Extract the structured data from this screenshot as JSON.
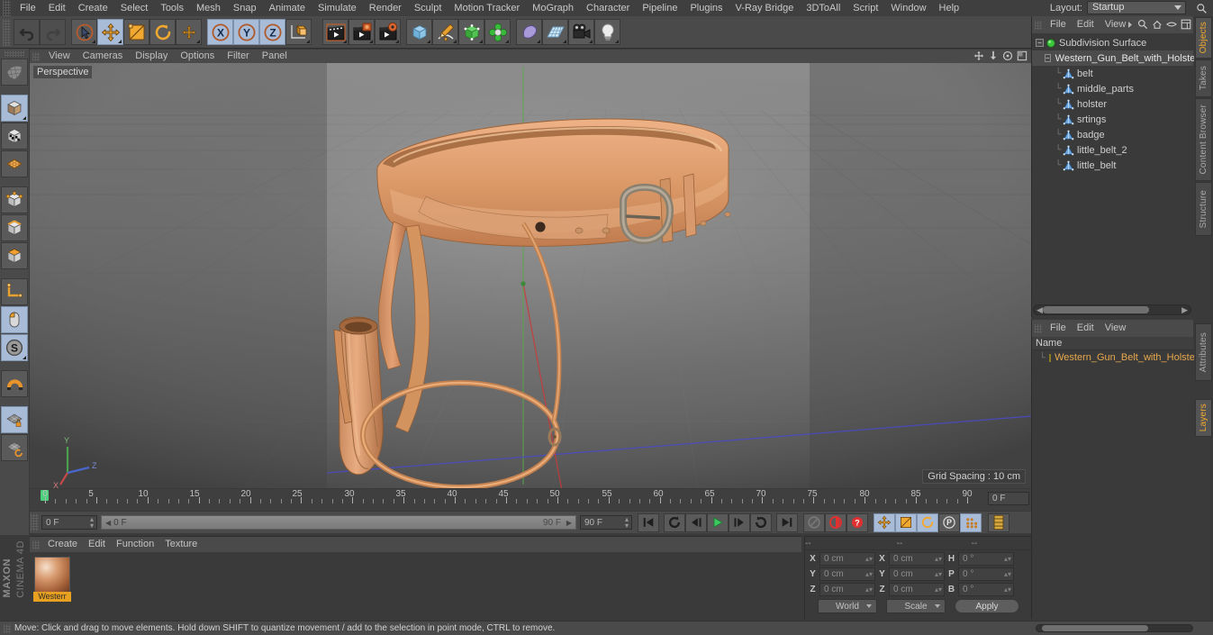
{
  "app": {
    "brand_line1": "MAXON",
    "brand_line2": "CINEMA 4D"
  },
  "menubar": {
    "items": [
      "File",
      "Edit",
      "Create",
      "Select",
      "Tools",
      "Mesh",
      "Snap",
      "Animate",
      "Simulate",
      "Render",
      "Sculpt",
      "Motion Tracker",
      "MoGraph",
      "Character",
      "Pipeline",
      "Plugins",
      "V-Ray Bridge",
      "3DToAll",
      "Script",
      "Window",
      "Help"
    ],
    "layout_label": "Layout:",
    "layout_value": "Startup",
    "search_icon": "magnifier-icon"
  },
  "toolbar": {
    "buttons": [
      {
        "name": "undo-button",
        "icon": "undo-arrow-icon",
        "selected": false
      },
      {
        "name": "redo-button",
        "icon": "redo-arrow-icon",
        "selected": false
      },
      {
        "name": "live-selection-tool",
        "icon": "cursor-circle-icon",
        "selected": false
      },
      {
        "name": "move-tool",
        "icon": "move-cross-icon",
        "selected": true
      },
      {
        "name": "scale-tool",
        "icon": "scale-square-icon",
        "selected": false
      },
      {
        "name": "rotate-tool",
        "icon": "rotate-circle-icon",
        "selected": false
      },
      {
        "name": "axis-move-tool",
        "icon": "small-cross-icon",
        "selected": false
      },
      {
        "name": "x-axis-lock",
        "icon": "x-axis-icon",
        "selected": true
      },
      {
        "name": "y-axis-lock",
        "icon": "y-axis-icon",
        "selected": true
      },
      {
        "name": "z-axis-lock",
        "icon": "z-axis-icon",
        "selected": true
      },
      {
        "name": "world-object-coordinate-toggle",
        "icon": "world-axis-cube-icon",
        "selected": false
      },
      {
        "name": "render-view-button",
        "icon": "clapperboard-icon",
        "selected": false
      },
      {
        "name": "render-region-button",
        "icon": "clapperboard-render-icon",
        "selected": false
      },
      {
        "name": "render-settings-button",
        "icon": "clapperboard-gear-icon",
        "selected": false
      },
      {
        "name": "add-cube-button",
        "icon": "blue-cube-icon",
        "selected": false
      },
      {
        "name": "add-spline-button",
        "icon": "pen-spline-icon",
        "selected": false
      },
      {
        "name": "nurbs-button",
        "icon": "green-cube-icon",
        "selected": false
      },
      {
        "name": "array-button",
        "icon": "green-clover-icon",
        "selected": false
      },
      {
        "name": "deformer-button",
        "icon": "purple-bend-icon",
        "selected": false
      },
      {
        "name": "scene-object-button",
        "icon": "floor-grid-icon",
        "selected": false
      },
      {
        "name": "camera-button",
        "icon": "camera-icon",
        "selected": false
      },
      {
        "name": "light-button",
        "icon": "lightbulb-icon",
        "selected": false
      }
    ]
  },
  "left_toolbar": {
    "buttons": [
      {
        "name": "make-editable-button",
        "icon": "editable-mesh-icon",
        "selected": false
      },
      {
        "name": "model-mode-button",
        "icon": "model-cube-icon",
        "selected": true
      },
      {
        "name": "texture-mode-button",
        "icon": "texture-cube-icon",
        "selected": false
      },
      {
        "name": "uv-mode-button",
        "icon": "uv-mesh-icon",
        "selected": false
      },
      {
        "name": "point-mode-button",
        "icon": "point-cube-icon",
        "selected": false
      },
      {
        "name": "edge-mode-button",
        "icon": "edge-cube-icon",
        "selected": false
      },
      {
        "name": "polygon-mode-button",
        "icon": "polygon-cube-icon",
        "selected": false
      },
      {
        "name": "axis-modification-button",
        "icon": "axis-corner-icon",
        "selected": false
      },
      {
        "name": "enable-snapping-button",
        "icon": "mouse-snap-icon",
        "selected": true
      },
      {
        "name": "workplane-button",
        "icon": "s-circle-icon",
        "selected": true
      },
      {
        "name": "magnet-button",
        "icon": "magnet-icon",
        "selected": false
      },
      {
        "name": "lock-workplane-button",
        "icon": "grid-lock-icon",
        "selected": true
      },
      {
        "name": "planar-workplane-button",
        "icon": "grid-rotate-icon",
        "selected": false
      }
    ]
  },
  "viewport": {
    "menu_items": [
      "View",
      "Cameras",
      "Display",
      "Options",
      "Filter",
      "Panel"
    ],
    "label": "Perspective",
    "grid_spacing": "Grid Spacing : 10 cm",
    "nav_icons": [
      "pan-icon",
      "zoom-icon",
      "orbit-icon",
      "maximize-icon"
    ],
    "axis_gizmo": {
      "x": "X",
      "y": "Y",
      "z": "Z"
    }
  },
  "object_manager": {
    "menu_items": [
      "File",
      "Edit",
      "View"
    ],
    "header_icons": [
      "arrow-right-icon",
      "search-icon",
      "home-icon",
      "eye-icon",
      "layout-icon"
    ],
    "tree": [
      {
        "name": "Subdivision Surface",
        "icon": "subdivision-surface-icon",
        "depth": 0,
        "selected": false,
        "type": "generator"
      },
      {
        "name": "Western_Gun_Belt_with_Holster",
        "icon": "null-object-icon",
        "depth": 1,
        "selected": true,
        "type": "null"
      },
      {
        "name": "belt",
        "icon": "polygon-object-icon",
        "depth": 2,
        "selected": false,
        "type": "mesh"
      },
      {
        "name": "middle_parts",
        "icon": "polygon-object-icon",
        "depth": 2,
        "selected": false,
        "type": "mesh"
      },
      {
        "name": "holster",
        "icon": "polygon-object-icon",
        "depth": 2,
        "selected": false,
        "type": "mesh"
      },
      {
        "name": "srtings",
        "icon": "polygon-object-icon",
        "depth": 2,
        "selected": false,
        "type": "mesh"
      },
      {
        "name": "badge",
        "icon": "polygon-object-icon",
        "depth": 2,
        "selected": false,
        "type": "mesh"
      },
      {
        "name": "little_belt_2",
        "icon": "polygon-object-icon",
        "depth": 2,
        "selected": false,
        "type": "mesh"
      },
      {
        "name": "little_belt",
        "icon": "polygon-object-icon",
        "depth": 2,
        "selected": false,
        "type": "mesh"
      }
    ]
  },
  "attributes_panel": {
    "menu_items": [
      "File",
      "Edit",
      "View"
    ],
    "column_header": "Name",
    "row_name": "Western_Gun_Belt_with_Holster",
    "row_color": "#e8c832"
  },
  "vertical_tabs": [
    {
      "label": "Objects",
      "active": true
    },
    {
      "label": "Takes",
      "active": false
    },
    {
      "label": "Content Browser",
      "active": false
    },
    {
      "label": "Structure",
      "active": false
    },
    {
      "label": "Attributes",
      "active": false
    },
    {
      "label": "Layers",
      "active": true
    }
  ],
  "timeline": {
    "ticks": [
      0,
      5,
      10,
      15,
      20,
      25,
      30,
      35,
      40,
      45,
      50,
      55,
      60,
      65,
      70,
      75,
      80,
      85,
      90
    ],
    "range_start": 0,
    "range_end": 90,
    "current_frame_field": "0 F",
    "end_frame_field": "0 F"
  },
  "powerbar": {
    "current_frame": "0 F",
    "preview_min": "0 F",
    "preview_max": "90 F",
    "doc_end": "90 F",
    "buttons": [
      {
        "name": "go-to-start-button",
        "icon": "skip-back-icon",
        "selected": false
      },
      {
        "name": "play-backwards-loop-button",
        "icon": "loop-ccw-icon",
        "selected": false
      },
      {
        "name": "previous-frame-button",
        "icon": "step-back-icon",
        "selected": false
      },
      {
        "name": "play-button",
        "icon": "play-icon",
        "selected": false
      },
      {
        "name": "next-frame-button",
        "icon": "step-forward-icon",
        "selected": false
      },
      {
        "name": "play-forwards-loop-button",
        "icon": "loop-cw-icon",
        "selected": false
      },
      {
        "name": "go-to-end-button",
        "icon": "skip-forward-icon",
        "selected": false
      },
      {
        "name": "record-active-objects-button",
        "icon": "record-disabled-icon",
        "selected": false
      },
      {
        "name": "autokeying-button",
        "icon": "autokey-red-icon",
        "selected": false
      },
      {
        "name": "keyframe-selection-button",
        "icon": "question-red-icon",
        "selected": false
      },
      {
        "name": "position-key-button",
        "icon": "move-cross-icon",
        "selected": true
      },
      {
        "name": "scale-key-button",
        "icon": "scale-square-icon",
        "selected": true
      },
      {
        "name": "rotation-key-button",
        "icon": "rotate-circle-icon",
        "selected": true
      },
      {
        "name": "parameter-key-button",
        "icon": "p-circle-icon",
        "selected": false
      },
      {
        "name": "point-level-animation-button",
        "icon": "dots-grid-icon",
        "selected": true
      },
      {
        "name": "timeline-layout-button",
        "icon": "timeline-icon",
        "selected": false
      }
    ]
  },
  "material_manager": {
    "menu_items": [
      "Create",
      "Edit",
      "Function",
      "Texture"
    ],
    "materials": [
      {
        "name": "Westerr",
        "swatch_color": "#c8844e"
      }
    ]
  },
  "coordinates": {
    "headers": [
      "--",
      "--",
      "--"
    ],
    "position": {
      "label_x": "X",
      "x": "0 cm",
      "label_y": "Y",
      "y": "0 cm",
      "label_z": "Z",
      "z": "0 cm"
    },
    "size": {
      "label_x": "X",
      "x": "0 cm",
      "label_y": "Y",
      "y": "0 cm",
      "label_z": "Z",
      "z": "0 cm"
    },
    "rotation": {
      "label_h": "H",
      "h": "0 °",
      "label_p": "P",
      "p": "0 °",
      "label_b": "B",
      "b": "0 °"
    },
    "coord_system": "World",
    "size_mode": "Scale",
    "apply_label": "Apply"
  },
  "statusbar": {
    "message": "Move: Click and drag to move elements. Hold down SHIFT to quantize movement / add to the selection in point mode, CTRL to remove."
  }
}
